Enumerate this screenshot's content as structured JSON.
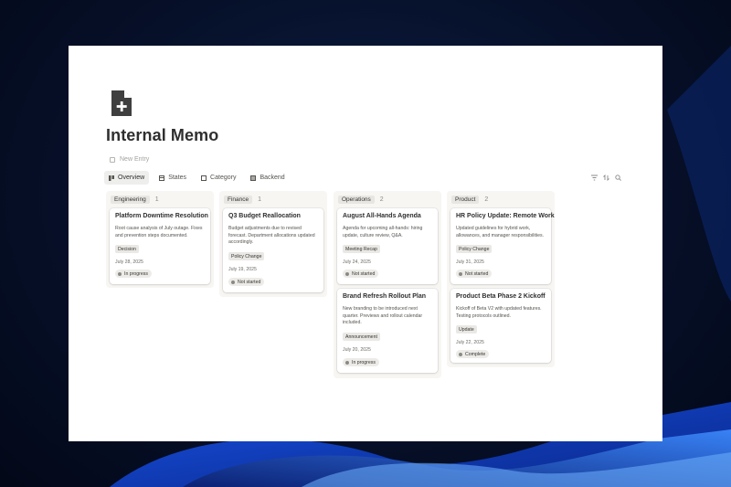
{
  "page": {
    "title": "Internal Memo",
    "new_entry": "New Entry",
    "icon": "document-plus-icon"
  },
  "tabs": [
    {
      "label": "Overview",
      "active": true,
      "icon": "board-icon"
    },
    {
      "label": "States",
      "active": false,
      "icon": "states-icon"
    },
    {
      "label": "Category",
      "active": false,
      "icon": "category-icon"
    },
    {
      "label": "Backend",
      "active": false,
      "icon": "backend-icon"
    }
  ],
  "tools": [
    "filter-icon",
    "sort-icon",
    "search-icon"
  ],
  "columns": [
    {
      "name": "Engineering",
      "count": "1",
      "cards": [
        {
          "title": "Platform Downtime Resolution",
          "desc": "Root cause analysis of July outage. Fixes and prevention steps documented.",
          "tag": "Decision",
          "date": "July 28, 2025",
          "status": "In progress"
        }
      ]
    },
    {
      "name": "Finance",
      "count": "1",
      "cards": [
        {
          "title": "Q3 Budget Reallocation",
          "desc": "Budget adjustments due to revised forecast. Department allocations updated accordingly.",
          "tag": "Policy Change",
          "date": "July 19, 2025",
          "status": "Not started"
        }
      ]
    },
    {
      "name": "Operations",
      "count": "2",
      "cards": [
        {
          "title": "August All-Hands Agenda",
          "desc": "Agenda for upcoming all-hands: hiring update, culture review, Q&A.",
          "tag": "Meeting Recap",
          "date": "July 24, 2025",
          "status": "Not started"
        },
        {
          "title": "Brand Refresh Rollout Plan",
          "desc": "New branding to be introduced next quarter. Previews and rollout calendar included.",
          "tag": "Announcement",
          "date": "July 20, 2025",
          "status": "In progress"
        }
      ]
    },
    {
      "name": "Product",
      "count": "2",
      "cards": [
        {
          "title": "HR Policy Update: Remote Work",
          "desc": "Updated guidelines for hybrid work, allowances, and manager responsibilities.",
          "tag": "Policy Change",
          "date": "July 31, 2025",
          "status": "Not started"
        },
        {
          "title": "Product Beta Phase 2 Kickoff",
          "desc": "Kickoff of Beta V2 with updated features. Testing protocols outlined.",
          "tag": "Update",
          "date": "July 22, 2025",
          "status": "Complete"
        }
      ]
    }
  ]
}
